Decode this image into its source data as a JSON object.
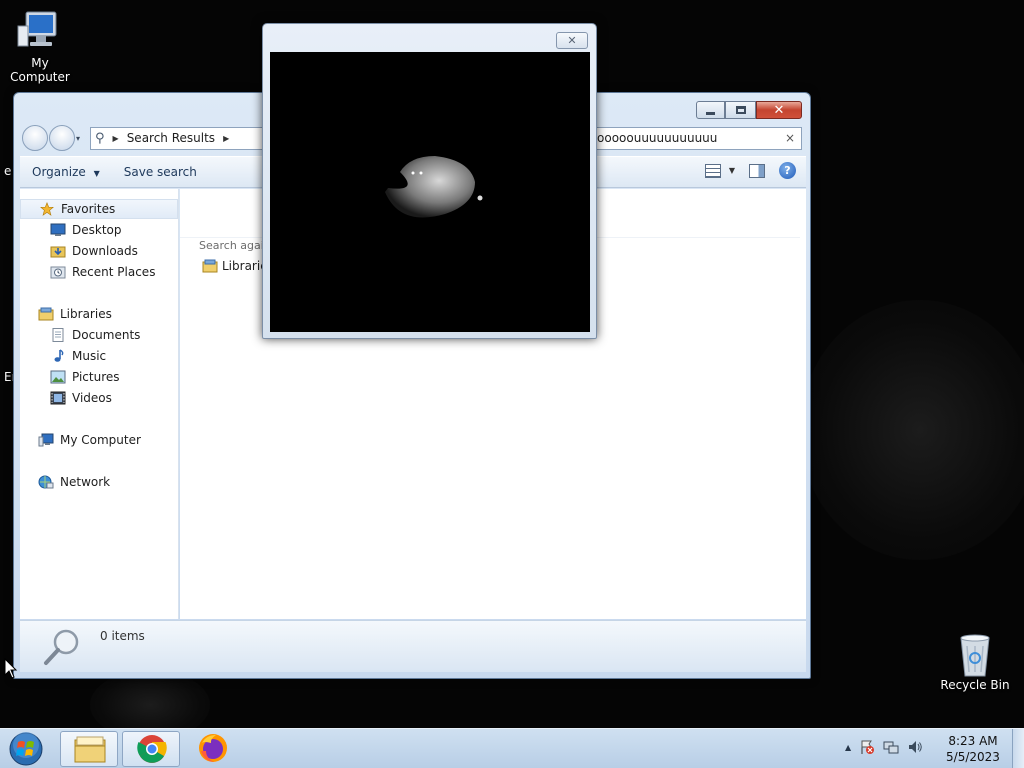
{
  "desktop": {
    "icons": [
      {
        "label": "My Computer",
        "icon": "computer-icon"
      },
      {
        "label": "Recycle Bin",
        "icon": "recycle-bin-icon"
      }
    ],
    "edge_text_1": "e",
    "edge_text_2": "Er"
  },
  "explorer": {
    "caption_buttons": [
      "minimize",
      "maximize",
      "close"
    ],
    "address": {
      "breadcrumb": [
        "Search Results"
      ]
    },
    "search": {
      "value": "yyyoooooooooouuuuuuuuuuu",
      "clear": "×"
    },
    "toolbar": {
      "organize": "Organize",
      "save_search": "Save search"
    },
    "nav": {
      "favorites": "Favorites",
      "desktop": "Desktop",
      "downloads": "Downloads",
      "recent_places": "Recent Places",
      "libraries": "Libraries",
      "documents": "Documents",
      "music": "Music",
      "pictures": "Pictures",
      "videos": "Videos",
      "my_computer": "My Computer",
      "network": "Network"
    },
    "content": {
      "search_again": "Search again in:",
      "library_item": "Libraries"
    },
    "details": {
      "count": "0 items"
    }
  },
  "popup": {
    "close": "✕"
  },
  "taskbar": {
    "time": "8:23 AM",
    "date": "5/5/2023",
    "tray_arrow": "▲"
  }
}
